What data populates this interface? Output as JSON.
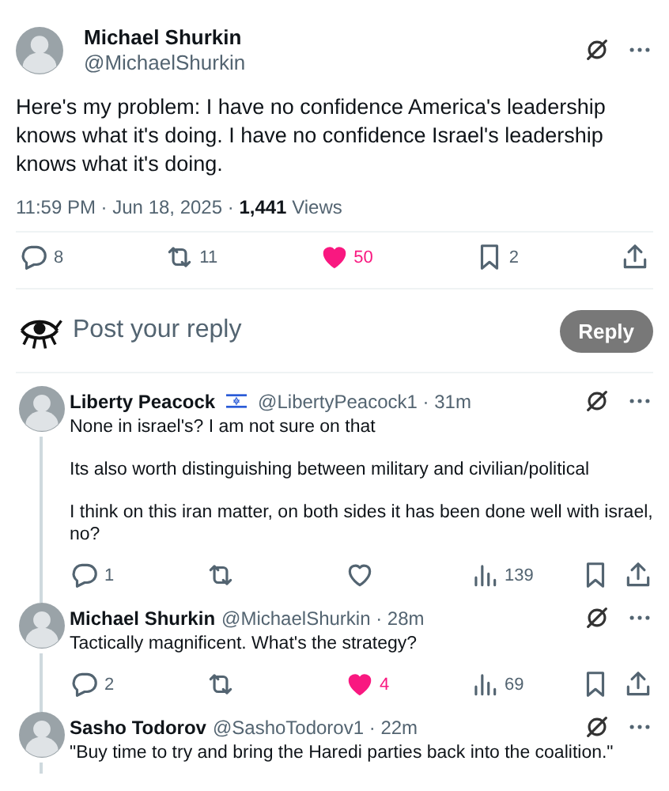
{
  "post": {
    "author": "Michael Shurkin",
    "handle": "@MichaelShurkin",
    "text": "Here's my problem: I have no confidence America's leadership knows what it's doing. I have no confidence Israel's leadership knows what it's doing.",
    "meta": "11:59 PM · Jun 18, 2025 · **1,441** Views",
    "actions": [
      {
        "kind": "reply",
        "count": "8"
      },
      {
        "kind": "repost",
        "count": "11"
      },
      {
        "kind": "like",
        "count": "50",
        "selected": true
      },
      {
        "kind": "bookmark",
        "count": "2"
      },
      {
        "kind": "share"
      }
    ]
  },
  "composer": {
    "placeholder": "Post your reply",
    "button": "Reply"
  },
  "replies": [
    {
      "author": "Liberty Peacock",
      "flag": true,
      "meta": "@LibertyPeacock1 · 31m",
      "paragraphs": [
        "None in israel's? I am not sure on that",
        "Its also worth distinguishing between military and civilian/political",
        "I think on this iran matter, on both sides it has been done well with israel, no?"
      ],
      "actions": [
        {
          "kind": "reply",
          "count": "1"
        },
        {
          "kind": "repost"
        },
        {
          "kind": "like",
          "selected": false
        },
        {
          "kind": "views",
          "count": "139"
        },
        {
          "kind": "bookmark"
        },
        {
          "kind": "share"
        }
      ]
    },
    {
      "author": "Michael Shurkin",
      "flag": false,
      "meta": "@MichaelShurkin · 28m",
      "paragraphs": [
        "Tactically magnificent. What's the strategy?"
      ],
      "actions": [
        {
          "kind": "reply",
          "count": "2"
        },
        {
          "kind": "repost"
        },
        {
          "kind": "like",
          "count": "4",
          "selected": true
        },
        {
          "kind": "views",
          "count": "69"
        },
        {
          "kind": "bookmark"
        },
        {
          "kind": "share"
        }
      ]
    },
    {
      "author": "Sasho Todorov",
      "flag": false,
      "meta": "@SashoTodorov1 · 22m",
      "paragraphs": [
        "\"Buy time to try and bring the Haredi parties back into the coalition.\""
      ]
    }
  ]
}
